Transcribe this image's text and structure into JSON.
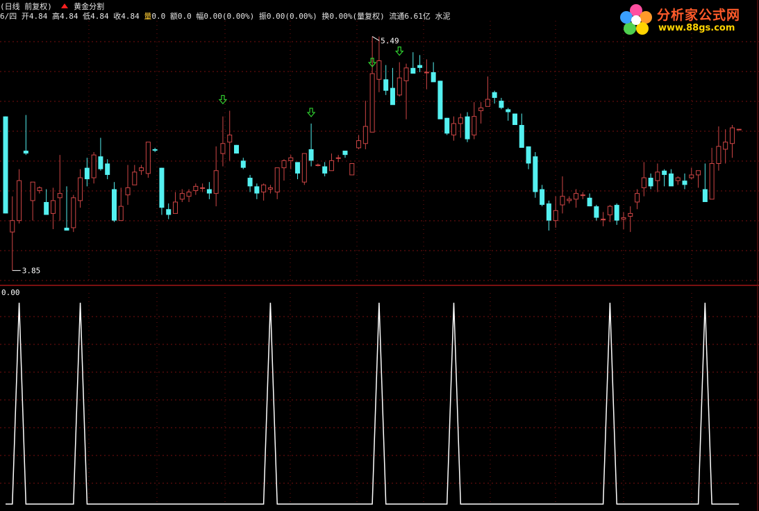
{
  "header": {
    "period_label": "(日线 前复权)",
    "indicator_name": "黄金分割",
    "quote_line": [
      {
        "k": "6/四",
        "v": "",
        "hl": false
      },
      {
        "k": " 开",
        "v": "4.84",
        "hl": false
      },
      {
        "k": " 高",
        "v": "4.84",
        "hl": false
      },
      {
        "k": " 低",
        "v": "4.84",
        "hl": false
      },
      {
        "k": " 收",
        "v": "4.84",
        "hl": false
      },
      {
        "k": " 量",
        "v": "0.0",
        "hl": true
      },
      {
        "k": " 额",
        "v": "0.0",
        "hl": false
      },
      {
        "k": " 幅",
        "v": "0.00(0.00%)",
        "hl": false
      },
      {
        "k": " 振",
        "v": "0.00(0.00%)",
        "hl": false
      },
      {
        "k": " 换",
        "v": "0.00%(量复权)",
        "hl": false
      },
      {
        "k": " 流通",
        "v": "6.61亿 水泥",
        "hl": false
      }
    ]
  },
  "logo": {
    "title": "分析家公式网",
    "url": "www.88gs.com"
  },
  "colors": {
    "background": "#000000",
    "up_candle": "#d04646",
    "down_candle": "#54f0f0",
    "grid": "#7a1010",
    "separator": "#7a1010",
    "indicator_line": "#ffffff",
    "signal_arrow": "#30d030",
    "axis_text": "#ffffff"
  },
  "chart_data": [
    {
      "type": "candlestick",
      "max_label": "5.49",
      "min_label": "3.85",
      "ylim": [
        3.78,
        5.6
      ],
      "grid": true,
      "candles": [
        [
          4.93,
          4.93,
          4.25,
          4.25
        ],
        [
          4.12,
          4.37,
          3.85,
          4.2
        ],
        [
          4.2,
          4.56,
          4.18,
          4.48
        ],
        [
          4.69,
          4.94,
          4.66,
          4.67
        ],
        [
          4.34,
          4.45,
          4.2,
          4.47
        ],
        [
          4.41,
          4.44,
          4.39,
          4.43
        ],
        [
          4.33,
          4.42,
          4.26,
          4.24
        ],
        [
          4.25,
          4.43,
          4.14,
          4.34
        ],
        [
          4.36,
          4.66,
          4.2,
          4.39
        ],
        [
          4.15,
          4.44,
          4.13,
          4.13
        ],
        [
          4.15,
          4.38,
          4.12,
          4.36
        ],
        [
          4.34,
          4.56,
          4.29,
          4.5
        ],
        [
          4.57,
          4.64,
          4.44,
          4.49
        ],
        [
          4.5,
          4.68,
          4.46,
          4.66
        ],
        [
          4.65,
          4.78,
          4.55,
          4.56
        ],
        [
          4.6,
          4.63,
          4.49,
          4.52
        ],
        [
          4.42,
          4.47,
          4.19,
          4.2
        ],
        [
          4.2,
          4.43,
          4.2,
          4.3
        ],
        [
          4.38,
          4.59,
          4.31,
          4.43
        ],
        [
          4.45,
          4.59,
          4.45,
          4.54
        ],
        [
          4.55,
          4.59,
          4.52,
          4.57
        ],
        [
          4.53,
          4.72,
          4.5,
          4.75
        ],
        [
          4.7,
          4.71,
          4.68,
          4.69
        ],
        [
          4.57,
          4.57,
          4.24,
          4.29
        ],
        [
          4.28,
          4.32,
          4.21,
          4.24
        ],
        [
          4.25,
          4.4,
          4.25,
          4.33
        ],
        [
          4.35,
          4.42,
          4.33,
          4.39
        ],
        [
          4.37,
          4.42,
          4.33,
          4.4
        ],
        [
          4.41,
          4.46,
          4.38,
          4.44
        ],
        [
          4.43,
          4.46,
          4.4,
          4.43
        ],
        [
          4.42,
          4.47,
          4.35,
          4.39
        ],
        [
          4.39,
          4.72,
          4.3,
          4.55
        ],
        [
          4.67,
          4.93,
          4.58,
          4.74
        ],
        [
          4.75,
          4.97,
          4.62,
          4.8
        ],
        [
          4.73,
          4.73,
          4.67,
          4.67
        ],
        [
          4.62,
          4.64,
          4.56,
          4.57
        ],
        [
          4.5,
          4.52,
          4.4,
          4.44
        ],
        [
          4.44,
          4.46,
          4.35,
          4.39
        ],
        [
          4.4,
          4.46,
          4.34,
          4.45
        ],
        [
          4.42,
          4.45,
          4.39,
          4.43
        ],
        [
          4.4,
          4.57,
          4.35,
          4.57
        ],
        [
          4.57,
          4.63,
          4.48,
          4.62
        ],
        [
          4.62,
          4.66,
          4.56,
          4.64
        ],
        [
          4.61,
          4.61,
          4.49,
          4.53
        ],
        [
          4.47,
          4.67,
          4.45,
          4.67
        ],
        [
          4.7,
          4.88,
          4.58,
          4.62
        ],
        [
          4.59,
          4.6,
          4.58,
          4.59
        ],
        [
          4.58,
          4.61,
          4.51,
          4.53
        ],
        [
          4.55,
          4.67,
          4.55,
          4.62
        ],
        [
          4.64,
          4.66,
          4.61,
          4.64
        ],
        [
          4.69,
          4.69,
          4.64,
          4.66
        ],
        [
          4.52,
          4.59,
          4.52,
          4.6
        ],
        [
          4.71,
          4.8,
          4.7,
          4.76
        ],
        [
          4.74,
          5.04,
          4.7,
          4.86
        ],
        [
          4.82,
          5.49,
          4.82,
          5.23
        ],
        [
          5.19,
          5.49,
          5.1,
          5.32
        ],
        [
          5.19,
          5.29,
          5.08,
          5.11
        ],
        [
          5.13,
          5.27,
          5.03,
          5.01
        ],
        [
          5.08,
          5.31,
          5.07,
          5.2
        ],
        [
          5.18,
          5.3,
          4.91,
          5.27
        ],
        [
          5.27,
          5.38,
          5.27,
          5.23
        ],
        [
          5.29,
          5.36,
          5.24,
          5.27
        ],
        [
          5.24,
          5.33,
          5.12,
          5.24
        ],
        [
          5.24,
          5.31,
          5.18,
          5.17
        ],
        [
          5.18,
          5.18,
          4.93,
          4.91
        ],
        [
          4.92,
          4.92,
          4.8,
          4.81
        ],
        [
          4.8,
          4.93,
          4.76,
          4.88
        ],
        [
          4.88,
          4.95,
          4.78,
          4.92
        ],
        [
          4.93,
          4.96,
          4.75,
          4.77
        ],
        [
          4.8,
          5.03,
          4.77,
          4.93
        ],
        [
          4.97,
          5.03,
          4.88,
          4.99
        ],
        [
          5.0,
          5.21,
          5.0,
          5.05
        ],
        [
          5.1,
          5.11,
          5.02,
          5.06
        ],
        [
          5.04,
          5.06,
          4.98,
          4.99
        ],
        [
          4.98,
          4.99,
          4.9,
          4.96
        ],
        [
          4.95,
          4.95,
          4.88,
          4.87
        ],
        [
          4.87,
          4.95,
          4.75,
          4.71
        ],
        [
          4.72,
          4.72,
          4.56,
          4.6
        ],
        [
          4.65,
          4.68,
          4.36,
          4.4
        ],
        [
          4.42,
          4.45,
          4.3,
          4.31
        ],
        [
          4.32,
          4.34,
          4.13,
          4.2
        ],
        [
          4.2,
          4.37,
          4.15,
          4.27
        ],
        [
          4.31,
          4.51,
          4.25,
          4.37
        ],
        [
          4.34,
          4.37,
          4.32,
          4.35
        ],
        [
          4.35,
          4.42,
          4.29,
          4.39
        ],
        [
          4.38,
          4.4,
          4.35,
          4.38
        ],
        [
          4.36,
          4.39,
          4.3,
          4.3
        ],
        [
          4.3,
          4.31,
          4.2,
          4.22
        ],
        [
          4.21,
          4.26,
          4.16,
          4.21
        ],
        [
          4.24,
          4.31,
          4.19,
          4.3
        ],
        [
          4.31,
          4.32,
          4.17,
          4.2
        ],
        [
          4.21,
          4.26,
          4.14,
          4.22
        ],
        [
          4.23,
          4.3,
          4.12,
          4.25
        ],
        [
          4.33,
          4.42,
          4.28,
          4.39
        ],
        [
          4.43,
          4.61,
          4.37,
          4.5
        ],
        [
          4.5,
          4.53,
          4.42,
          4.44
        ],
        [
          4.48,
          4.6,
          4.4,
          4.54
        ],
        [
          4.55,
          4.56,
          4.44,
          4.52
        ],
        [
          4.53,
          4.56,
          4.46,
          4.44
        ],
        [
          4.48,
          4.51,
          4.45,
          4.5
        ],
        [
          4.48,
          4.53,
          4.42,
          4.45
        ],
        [
          4.5,
          4.57,
          4.49,
          4.52
        ],
        [
          4.52,
          4.55,
          4.43,
          4.55
        ],
        [
          4.42,
          4.6,
          4.35,
          4.33
        ],
        [
          4.35,
          4.71,
          4.35,
          4.6
        ],
        [
          4.6,
          4.86,
          4.55,
          4.72
        ],
        [
          4.7,
          4.84,
          4.6,
          4.75
        ],
        [
          4.74,
          4.87,
          4.64,
          4.85
        ],
        [
          4.84,
          4.84,
          4.84,
          4.84
        ]
      ],
      "signal_arrows": [
        {
          "index": 32,
          "price": 4.97
        },
        {
          "index": 45,
          "price": 4.88
        },
        {
          "index": 54,
          "price": 5.23
        },
        {
          "index": 58,
          "price": 5.31
        }
      ]
    },
    {
      "type": "line",
      "value_label": "0.00",
      "ylim": [
        0,
        1
      ],
      "spikes": [
        2,
        11,
        39,
        55,
        66,
        89,
        103
      ]
    }
  ]
}
